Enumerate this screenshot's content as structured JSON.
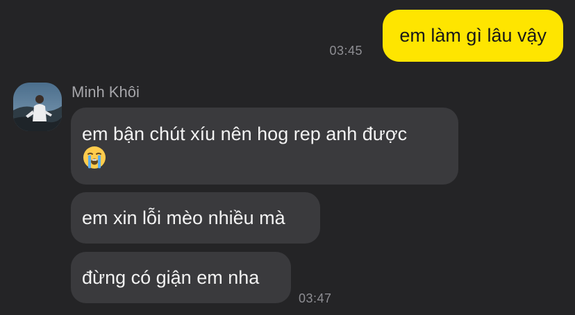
{
  "outgoing": {
    "message": "em làm gì lâu vậy",
    "time": "03:45"
  },
  "incoming": {
    "sender_name": "Minh Khôi",
    "messages": [
      "em bận chút xíu nên hog rep anh được",
      "em xin lỗi mèo nhiều mà",
      "đừng có giận em nha"
    ],
    "emoji": "loudly-crying-face-icon",
    "time": "03:47"
  },
  "colors": {
    "background": "#242426",
    "outgoing_bubble": "#FEE500",
    "incoming_bubble": "#3A3A3D",
    "timestamp": "#8E8E93"
  }
}
